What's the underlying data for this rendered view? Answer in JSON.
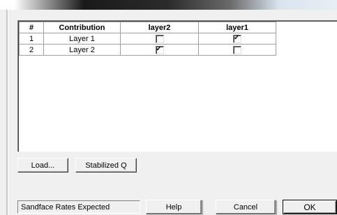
{
  "table": {
    "headers": [
      "#",
      "Contribution",
      "layer2",
      "layer1"
    ],
    "rows": [
      {
        "num": "1",
        "name": "Layer 1",
        "layer2": false,
        "layer1": true
      },
      {
        "num": "2",
        "name": "Layer 2",
        "layer2": true,
        "layer1": false
      }
    ]
  },
  "buttons": {
    "load": "Load...",
    "stabilized": "Stabilized Q",
    "help": "Help",
    "cancel": "Cancel",
    "ok": "OK"
  },
  "status": {
    "text": "Sandface Rates Expected"
  }
}
